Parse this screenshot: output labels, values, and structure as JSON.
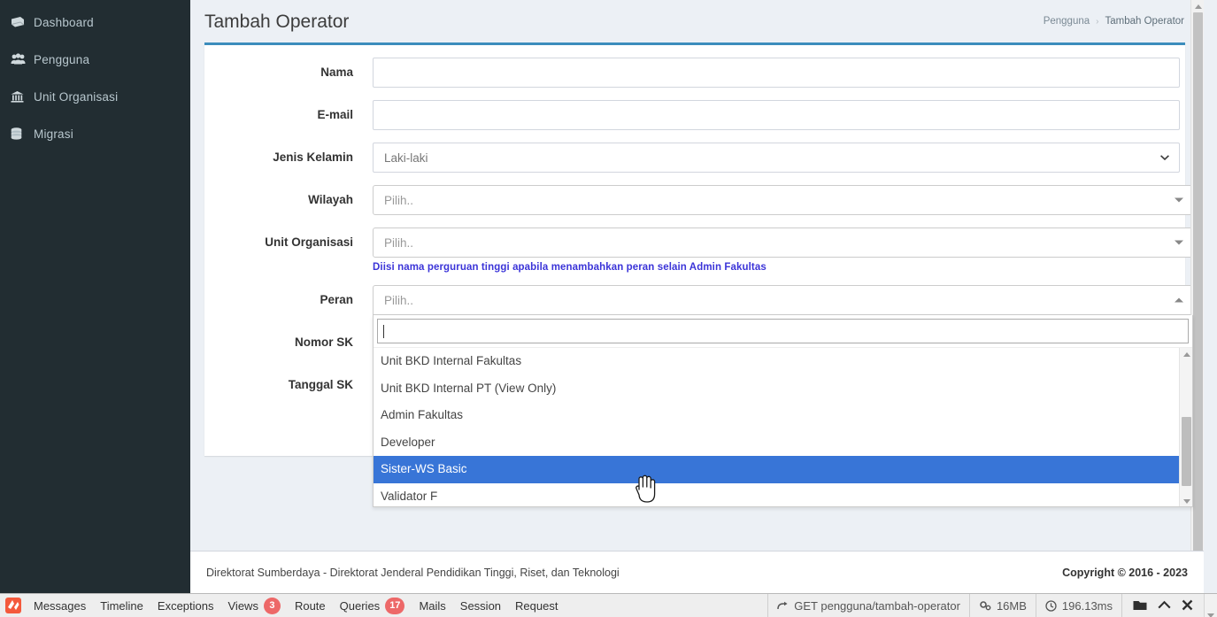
{
  "sidebar": {
    "items": [
      {
        "label": "Dashboard",
        "icon": "dashboard-icon"
      },
      {
        "label": "Pengguna",
        "icon": "users-icon"
      },
      {
        "label": "Unit Organisasi",
        "icon": "bank-icon"
      },
      {
        "label": "Migrasi",
        "icon": "database-icon"
      }
    ]
  },
  "header": {
    "title": "Tambah Operator",
    "breadcrumb": {
      "parent": "Pengguna",
      "separator": "›",
      "current": "Tambah Operator"
    }
  },
  "form": {
    "fields": [
      {
        "label": "Nama",
        "type": "text",
        "value": "",
        "placeholder": ""
      },
      {
        "label": "E-mail",
        "type": "text",
        "value": "",
        "placeholder": ""
      },
      {
        "label": "Jenis Kelamin",
        "type": "native-select",
        "value": "Laki-laki"
      },
      {
        "label": "Wilayah",
        "type": "select2",
        "value": "Pilih.."
      },
      {
        "label": "Unit Organisasi",
        "type": "select2",
        "value": "Pilih.."
      },
      {
        "label": "Peran",
        "type": "select2-open",
        "value": "Pilih.."
      },
      {
        "label": "Nomor SK",
        "type": "text",
        "value": "",
        "placeholder": ""
      },
      {
        "label": "Tanggal SK",
        "type": "text",
        "value": "",
        "placeholder": ""
      }
    ],
    "help_text": "Diisi nama perguruan tinggi apabila menambahkan peran selain Admin Fakultas"
  },
  "peran_dropdown": {
    "search_value": "",
    "search_placeholder": "",
    "options": [
      {
        "label": "Unit BKD Internal Fakultas",
        "highlighted": false
      },
      {
        "label": "Unit BKD Internal PT (View Only)",
        "highlighted": false
      },
      {
        "label": "Admin Fakultas",
        "highlighted": false
      },
      {
        "label": "Developer",
        "highlighted": false
      },
      {
        "label": "Sister-WS Basic",
        "highlighted": true
      },
      {
        "label": "Validator F",
        "highlighted": false
      }
    ],
    "highlight_color": "#3875d7"
  },
  "footer": {
    "left": "Direktorat Sumberdaya - Direktorat Jenderal Pendidikan Tinggi, Riset, dan Teknologi",
    "copyright": "Copyright © 2016 - 2023"
  },
  "debugbar": {
    "logo_icon": "laravel-logo-icon",
    "tabs": [
      {
        "label": "Messages",
        "badge": null
      },
      {
        "label": "Timeline",
        "badge": null
      },
      {
        "label": "Exceptions",
        "badge": null
      },
      {
        "label": "Views",
        "badge": "3"
      },
      {
        "label": "Route",
        "badge": null
      },
      {
        "label": "Queries",
        "badge": "17"
      },
      {
        "label": "Mails",
        "badge": null
      },
      {
        "label": "Session",
        "badge": null
      },
      {
        "label": "Request",
        "badge": null
      }
    ],
    "route": "GET pengguna/tambah-operator",
    "memory": "16MB",
    "time": "196.13ms",
    "badge_color": "#ed6868",
    "icons": [
      "folder-icon",
      "chevron-up-icon",
      "close-icon"
    ]
  },
  "theme": {
    "sidebar_bg": "#222d32",
    "accent": "#3c8dbc",
    "page_bg": "#ecf0f5",
    "help_text_color": "#3b34d8"
  }
}
